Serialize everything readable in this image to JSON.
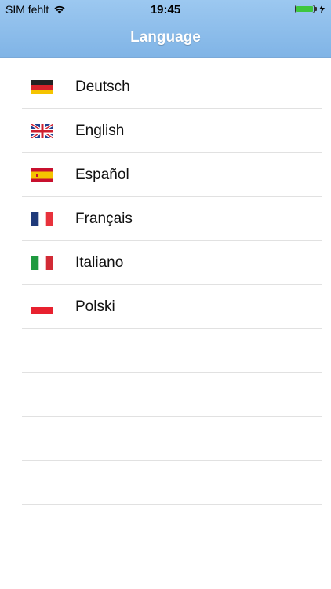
{
  "status_bar": {
    "carrier": "SIM fehlt",
    "time": "19:45"
  },
  "header": {
    "title": "Language"
  },
  "languages": [
    {
      "label": "Deutsch",
      "flag": "german-flag-icon"
    },
    {
      "label": "English",
      "flag": "uk-flag-icon"
    },
    {
      "label": "Español",
      "flag": "spanish-flag-icon"
    },
    {
      "label": "Français",
      "flag": "french-flag-icon"
    },
    {
      "label": "Italiano",
      "flag": "italian-flag-icon"
    },
    {
      "label": "Polski",
      "flag": "polish-flag-icon"
    }
  ],
  "colors": {
    "header_top": "#9cc8f0",
    "header_bottom": "#80b4e6",
    "battery": "#3ec63e",
    "separator": "#e1e1e1"
  }
}
